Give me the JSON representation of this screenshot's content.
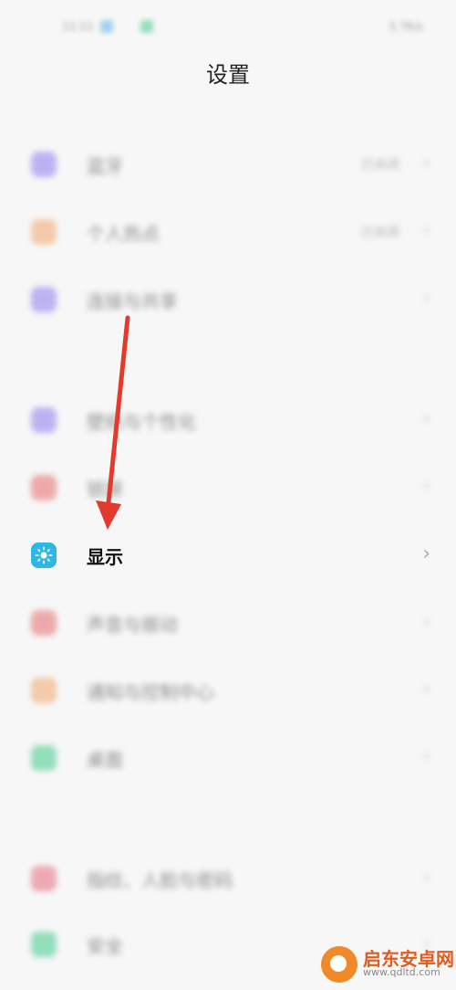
{
  "status_bar": {
    "left": "11:11",
    "right": "5.7K/s"
  },
  "header": {
    "title": "设置"
  },
  "rows": [
    {
      "label": "蓝牙",
      "value": "已关闭",
      "color": "#8d7bf0"
    },
    {
      "label": "个人热点",
      "value": "已关闭",
      "color": "#f0a46a"
    },
    {
      "label": "连接与共享",
      "value": "",
      "color": "#8d7bf0"
    },
    {
      "label": "壁纸与个性化",
      "value": "",
      "color": "#8d7bf0"
    },
    {
      "label": "锁屏",
      "value": "",
      "color": "#e56b6b"
    },
    {
      "label": "显示",
      "value": "",
      "color": "#2fb6e8"
    },
    {
      "label": "声音与振动",
      "value": "",
      "color": "#e56b6b"
    },
    {
      "label": "通知与控制中心",
      "value": "",
      "color": "#f0a46a"
    },
    {
      "label": "桌面",
      "value": "",
      "color": "#40c98a"
    },
    {
      "label": "指纹、人脸与密码",
      "value": "",
      "color": "#e56b7b"
    },
    {
      "label": "安全",
      "value": "",
      "color": "#40c98a"
    }
  ],
  "chevron": "›",
  "watermark": {
    "title": "启东安卓网",
    "url": "www.qdltd.com"
  }
}
